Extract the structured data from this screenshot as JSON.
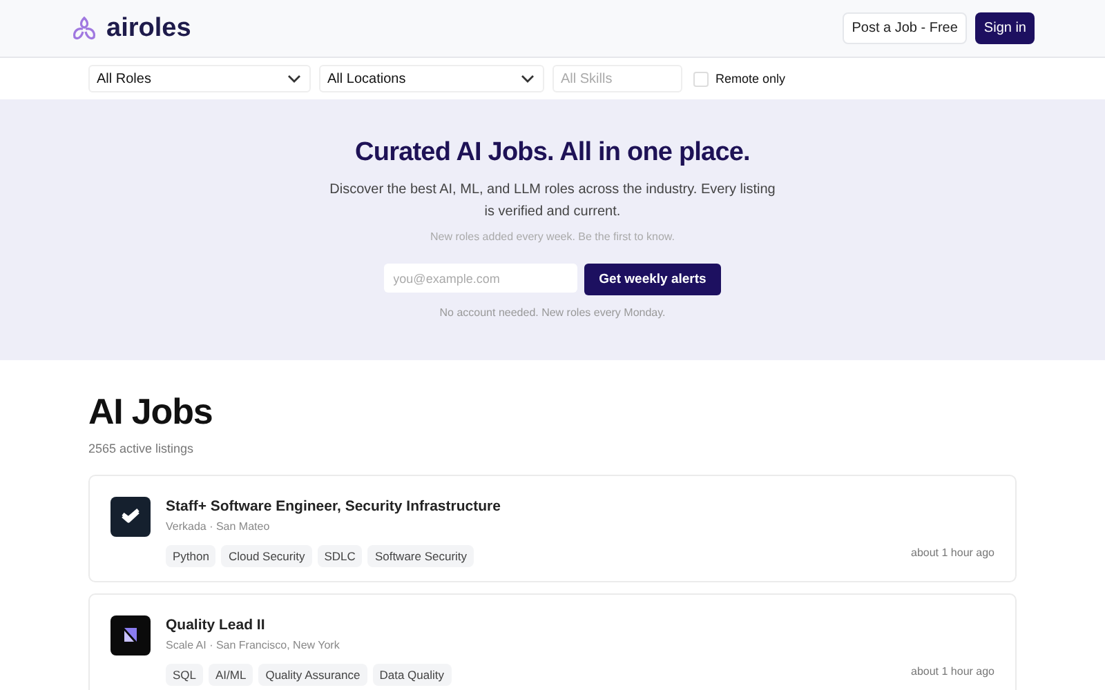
{
  "header": {
    "brand": "airoles",
    "post_button": "Post a Job - Free",
    "signin_button": "Sign in"
  },
  "filters": {
    "role": "All Roles",
    "location": "All Locations",
    "skills_placeholder": "All Skills",
    "remote": {
      "label": "Remote only",
      "checked": false
    }
  },
  "hero": {
    "title": "Curated AI Jobs. All in one place.",
    "subtitle": "Discover the best AI, ML, and LLM roles across the industry. Every listing is verified and current.",
    "note": "New roles added every week. Be the first to know.",
    "email_placeholder": "you@example.com",
    "cta": "Get weekly alerts",
    "footnote": "No account needed. New roles every Monday."
  },
  "listings": {
    "title": "AI Jobs",
    "count": "2565 active listings",
    "jobs": [
      {
        "title": "Staff+ Software Engineer, Security Infrastructure",
        "company": "Verkada · San Mateo",
        "tags": [
          "Python",
          "Cloud Security",
          "SDLC",
          "Software Security"
        ],
        "posted": "about 1 hour ago",
        "kind": "check"
      },
      {
        "title": "Quality Lead II",
        "company": "Scale AI · San Francisco, New York",
        "tags": [
          "SQL",
          "AI/ML",
          "Quality Assurance",
          "Data Quality"
        ],
        "posted": "about 1 hour ago",
        "kind": "scale"
      }
    ]
  }
}
